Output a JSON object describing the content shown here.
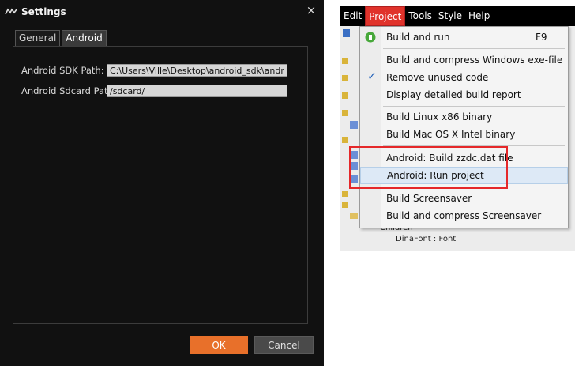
{
  "settings_dialog": {
    "title": "Settings",
    "close_glyph": "×",
    "tabs": [
      {
        "label": "General"
      },
      {
        "label": "Android"
      }
    ],
    "fields": {
      "sdk_path": {
        "label": "Android SDK Path:",
        "value": "C:\\Users\\Ville\\Desktop\\android_sdk\\android-sd"
      },
      "sdcard_path": {
        "label": "Android Sdcard Path:",
        "value": "/sdcard/"
      }
    },
    "ok_label": "OK",
    "cancel_label": "Cancel"
  },
  "menubar": {
    "items": [
      {
        "label": "Edit"
      },
      {
        "label": "Project"
      },
      {
        "label": "Tools"
      },
      {
        "label": "Style"
      },
      {
        "label": "Help"
      }
    ]
  },
  "project_menu": {
    "items": [
      {
        "label": "Build and run",
        "shortcut": "F9",
        "icon": "play-icon"
      },
      {
        "label": "Build and compress Windows exe-file"
      },
      {
        "label": "Remove unused code",
        "icon": "check-icon"
      },
      {
        "label": "Display detailed build report"
      },
      {
        "label": "Build Linux x86 binary"
      },
      {
        "label": "Build Mac OS X Intel binary"
      },
      {
        "label": "Android: Build zzdc.dat file"
      },
      {
        "label": "Android: Run project"
      },
      {
        "label": "Build Screensaver"
      },
      {
        "label": "Build and compress Screensaver"
      }
    ]
  },
  "tree_background": {
    "items": [
      {
        "label": "Children"
      },
      {
        "label": "DinaFont : Font"
      }
    ]
  },
  "colors": {
    "dialog_bg": "#111111",
    "ok_button": "#e8702a",
    "menu_highlight": "#e0332b",
    "annotation_box": "#e5282a"
  }
}
